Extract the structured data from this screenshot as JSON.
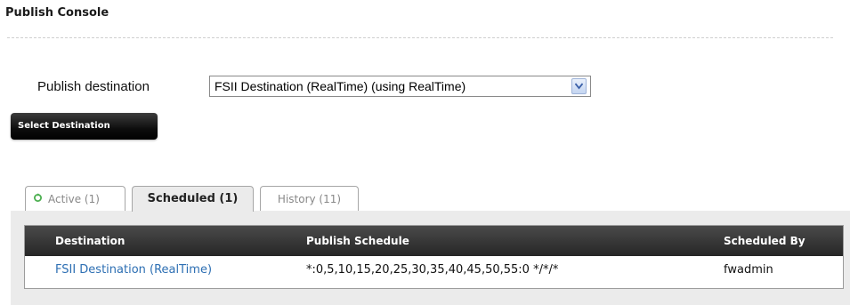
{
  "page": {
    "title": "Publish Console"
  },
  "destination": {
    "label": "Publish destination",
    "selected": "FSII Destination (RealTime) (using RealTime)",
    "button_label": "Select Destination"
  },
  "tabs": [
    {
      "label": "Active (1)",
      "icon": "refresh-icon",
      "selected": false
    },
    {
      "label": "Scheduled (1)",
      "selected": true
    },
    {
      "label": "History (11)",
      "selected": false
    }
  ],
  "table": {
    "columns": [
      "Destination",
      "Publish Schedule",
      "Scheduled By"
    ],
    "rows": [
      [
        "FSII Destination (RealTime)",
        "*:0,5,10,15,20,25,30,35,40,45,50,55:0 */*/*",
        "fwadmin"
      ]
    ]
  },
  "colors": {
    "link": "#2d6fb3",
    "header_bg": "#2f2f2f",
    "tab_panel_bg": "#ebebeb",
    "refresh_icon": "#4caf50"
  }
}
